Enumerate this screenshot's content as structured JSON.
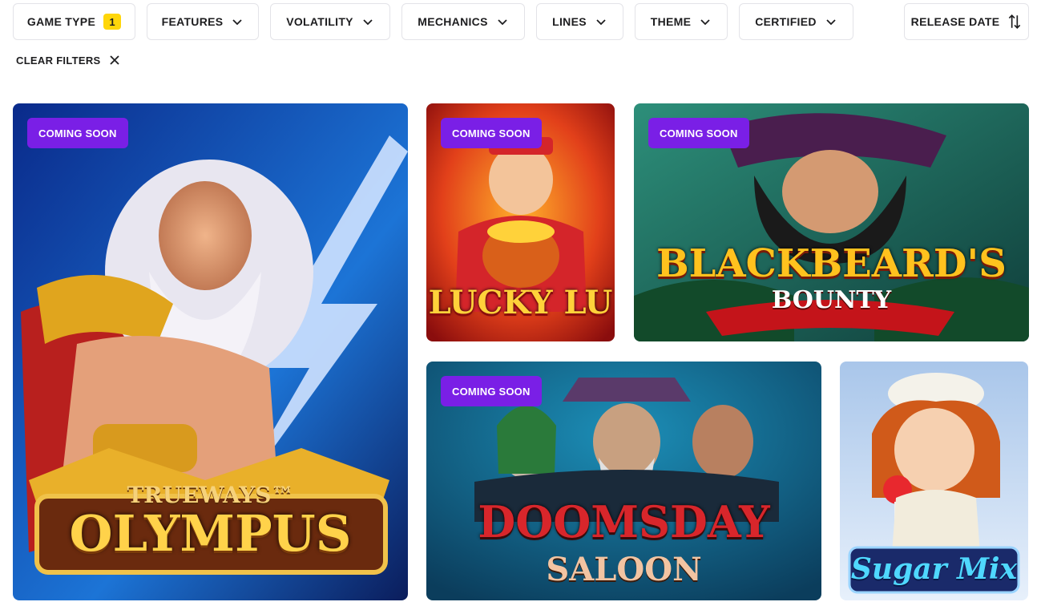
{
  "filters": [
    {
      "label": "GAME TYPE",
      "count": "1"
    },
    {
      "label": "FEATURES"
    },
    {
      "label": "VOLATILITY"
    },
    {
      "label": "MECHANICS"
    },
    {
      "label": "LINES"
    },
    {
      "label": "THEME"
    },
    {
      "label": "CERTIFIED"
    }
  ],
  "sort": {
    "label": "RELEASE DATE",
    "icon": "sort-arrows-icon"
  },
  "clear_filters": {
    "label": "CLEAR FILTERS",
    "icon": "close-icon"
  },
  "games": [
    {
      "title_top": "TRUEWAYS™",
      "title_main": "OLYMPUS",
      "badge": "COMING SOON",
      "colors": {
        "bg1": "#0a2a8a",
        "bg2": "#1c74d6",
        "accent": "#e8a822"
      }
    },
    {
      "title_main": "LUCKY LU",
      "badge": "COMING SOON",
      "colors": {
        "bg1": "#b8120e",
        "bg2": "#ff8a1c",
        "accent": "#ffd23a"
      }
    },
    {
      "title_main": "BLACKBEARD'S",
      "title_sub": "BOUNTY",
      "badge": "COMING SOON",
      "colors": {
        "bg1": "#0f3d3a",
        "bg2": "#2d8f7a",
        "accent": "#ffb11a"
      }
    },
    {
      "title_main": "DOOMSDAY",
      "title_sub": "SALOON",
      "badge": "COMING SOON",
      "colors": {
        "bg1": "#0b3d5c",
        "bg2": "#1c8fb8",
        "accent": "#d8262b"
      }
    },
    {
      "title_main": "Sugar Mix",
      "colors": {
        "bg1": "#a9c6ea",
        "bg2": "#e7f0fb",
        "accent": "#2fa3ff"
      }
    }
  ]
}
